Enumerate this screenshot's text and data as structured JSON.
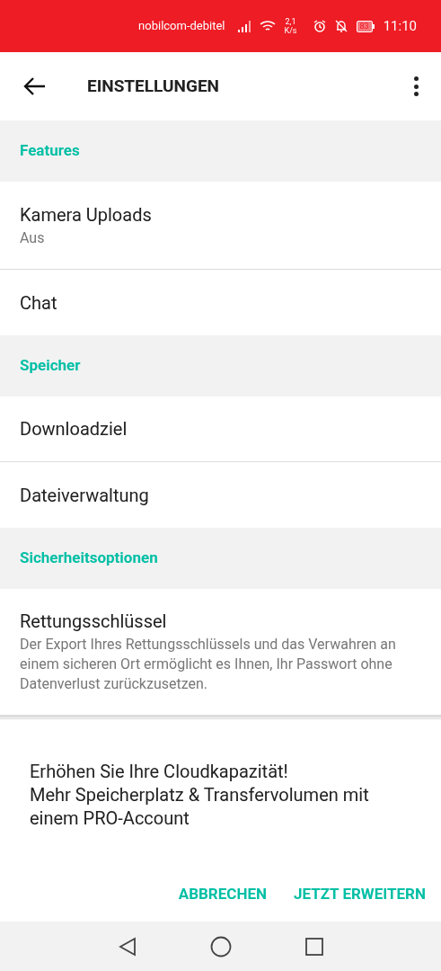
{
  "status_bar": {
    "carrier": "nobilcom-debitel",
    "speed_value": "2,1",
    "speed_unit": "K/s",
    "battery": "83",
    "time": "11:10"
  },
  "app_bar": {
    "title": "EINSTELLUNGEN"
  },
  "sections": [
    {
      "header": "Features",
      "items": [
        {
          "title": "Kamera Uploads",
          "subtitle": "Aus"
        },
        {
          "title": "Chat"
        }
      ]
    },
    {
      "header": "Speicher",
      "items": [
        {
          "title": "Downloadziel"
        },
        {
          "title": "Dateiverwaltung"
        }
      ]
    },
    {
      "header": "Sicherheitsoptionen",
      "items": [
        {
          "title": "Rettungsschlüssel",
          "subtitle": "Der Export Ihres Rettungsschlüssels und das Verwahren an einem sicheren Ort ermöglicht es Ihnen, Ihr Passwort ohne Datenverlust zurückzusetzen."
        }
      ]
    }
  ],
  "banner": {
    "lines": [
      "Erhöhen Sie Ihre Cloudkapazität!",
      "Mehr Speicherplatz & Transfervolumen mit einem PRO-Account"
    ],
    "buttons": [
      "ABBRECHEN",
      "JETZT ERWEITERN"
    ]
  }
}
